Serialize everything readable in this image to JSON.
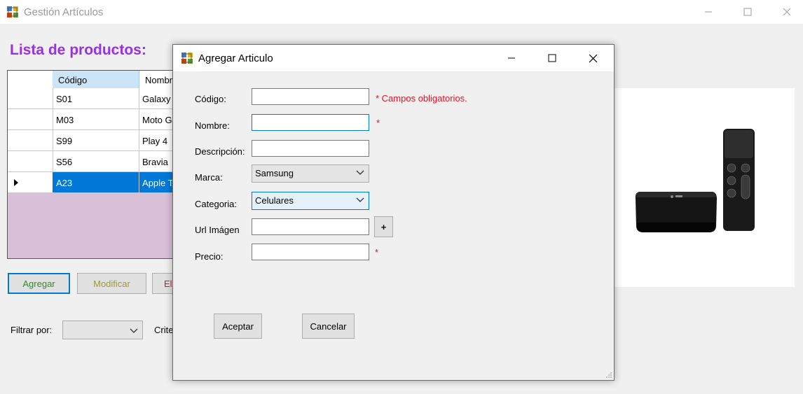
{
  "window": {
    "title": "Gestión Artículos"
  },
  "main": {
    "heading": "Lista de productos:",
    "grid": {
      "columns": [
        "Código",
        "Nombr"
      ],
      "rows": [
        {
          "code": "S01",
          "name": "Galaxy"
        },
        {
          "code": "M03",
          "name": "Moto G"
        },
        {
          "code": "S99",
          "name": "Play 4"
        },
        {
          "code": "S56",
          "name": "Bravia"
        },
        {
          "code": "A23",
          "name": "Apple T"
        }
      ],
      "selected_index": 4
    },
    "buttons": {
      "add": "Agregar",
      "modify": "Modificar",
      "delete": "El"
    },
    "filter": {
      "label": "Filtrar por:",
      "value": "",
      "criteria_label": "Crite"
    }
  },
  "dialog": {
    "title": "Agregar Articulo",
    "fields": {
      "codigo_label": "Código:",
      "nombre_label": "Nombre:",
      "descripcion_label": "Descripción:",
      "marca_label": "Marca:",
      "categoria_label": "Categoria:",
      "url_label": "Url Imágen",
      "precio_label": "Precio:",
      "codigo_value": "",
      "nombre_value": "",
      "descripcion_value": "",
      "url_value": "",
      "precio_value": "",
      "marca_value": "Samsung",
      "categoria_value": "Celulares"
    },
    "required_note": "* Campos obligatorios.",
    "required_mark": "*",
    "add_image_button": "+",
    "accept_button": "Aceptar",
    "cancel_button": "Cancelar"
  },
  "colors": {
    "heading": "#9b30e0",
    "selection": "#0078d7",
    "required": "#e81123",
    "grid_background": "#d8c1d8"
  }
}
